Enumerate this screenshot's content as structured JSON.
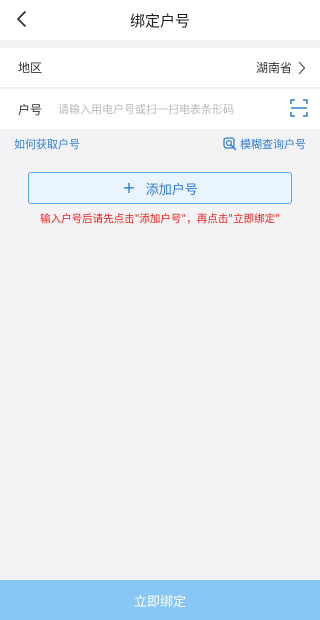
{
  "header": {
    "title": "绑定户号"
  },
  "form": {
    "region_label": "地区",
    "region_value": "湖南省",
    "account_label": "户号",
    "account_placeholder": "请输入用电户号或扫一扫电表条形码",
    "account_value": ""
  },
  "links": {
    "how_to_get": "如何获取户号",
    "fuzzy_query": "模糊查询户号"
  },
  "actions": {
    "add_account_plus": "+",
    "add_account": "添加户号",
    "hint": "输入户号后请先点击\"添加户号\"，再点击\"立即绑定\"",
    "bind_now": "立即绑定"
  },
  "colors": {
    "accent": "#2f7ed8",
    "hint_red": "#e8231e",
    "bottom_button": "#88c7f5",
    "background": "#f3f3f5"
  },
  "icons": {
    "back": "chevron-left-icon",
    "region_arrow": "chevron-right-icon",
    "scan": "scan-icon",
    "search": "search-icon"
  }
}
